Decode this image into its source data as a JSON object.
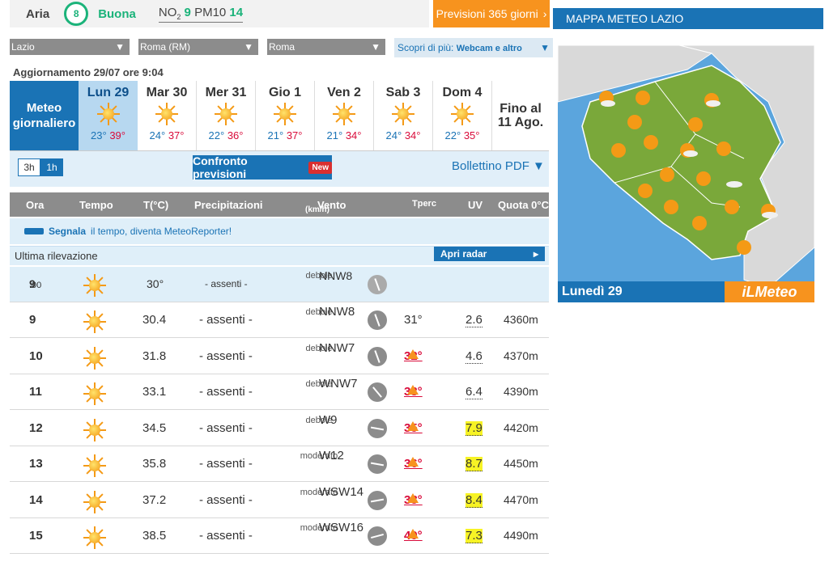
{
  "air": {
    "label": "Aria",
    "index": "8",
    "quality": "Buona",
    "no2_label": "NO",
    "no2_sub": "2",
    "no2_val": "9",
    "pm_label": "PM10",
    "pm_val": "14"
  },
  "btn365": "Previsioni 365 giorni",
  "map": {
    "title": "MAPPA METEO LAZIO",
    "day": "Lunedì 29",
    "logo": "iLMeteo"
  },
  "selects": {
    "region": "Lazio",
    "province": "Roma (RM)",
    "city": "Roma"
  },
  "scopri": {
    "label": "Scopri di più:",
    "value": "Webcam e altro"
  },
  "updated": "Aggiornamento 29/07 ore 9:04",
  "daily": {
    "label_line1": "Meteo",
    "label_line2": "giornaliero",
    "days": [
      {
        "name": "Lun 29",
        "min": "23°",
        "max": "39°"
      },
      {
        "name": "Mar 30",
        "min": "24°",
        "max": "37°"
      },
      {
        "name": "Mer 31",
        "min": "22°",
        "max": "36°"
      },
      {
        "name": "Gio 1",
        "min": "21°",
        "max": "37°"
      },
      {
        "name": "Ven 2",
        "min": "21°",
        "max": "34°"
      },
      {
        "name": "Sab 3",
        "min": "24°",
        "max": "34°"
      },
      {
        "name": "Dom 4",
        "min": "22°",
        "max": "35°"
      }
    ],
    "end_line1": "Fino al",
    "end_line2": "11 Ago."
  },
  "hours": {
    "h3": "3h",
    "h1": "1h"
  },
  "confronto": {
    "label": "Confronto previsioni",
    "badge": "New"
  },
  "pdf": "Bollettino PDF ▼",
  "table": {
    "headers": {
      "ora": "Ora",
      "tempo": "Tempo",
      "temp": "T(°C)",
      "prec": "Precipitazioni",
      "vento": "Vento",
      "vento_unit": "(km/h)",
      "tperc": "Tperc",
      "uv": "UV",
      "quota": "Quota 0°C"
    },
    "segnala_bold": "Segnala",
    "segnala_rest": "il tempo, diventa MeteoReporter!",
    "ultima": "Ultima rilevazione",
    "radar": "Apri radar",
    "current": {
      "ora": "9",
      "ora_min": ":00",
      "temp": "30°",
      "prec": "- assenti -",
      "wind": "NNW8",
      "wind_desc": "debole"
    },
    "rows": [
      {
        "ora": "9",
        "temp": "30.4",
        "prec": "- assenti -",
        "wind": "NNW8",
        "wind_desc": "debole",
        "tperc": "31°",
        "uv": "2.6",
        "quota": "4360m"
      },
      {
        "ora": "10",
        "temp": "31.8",
        "prec": "- assenti -",
        "wind": "NNW7",
        "wind_desc": "debole",
        "tperc": "32°",
        "uv": "4.6",
        "quota": "4370m"
      },
      {
        "ora": "11",
        "temp": "33.1",
        "prec": "- assenti -",
        "wind": "WNW7",
        "wind_desc": "debole",
        "tperc": "33°",
        "uv": "6.4",
        "quota": "4390m"
      },
      {
        "ora": "12",
        "temp": "34.5",
        "prec": "- assenti -",
        "wind": "W9",
        "wind_desc": "debole",
        "tperc": "35°",
        "uv": "7.9",
        "quota": "4420m"
      },
      {
        "ora": "13",
        "temp": "35.8",
        "prec": "- assenti -",
        "wind": "W12",
        "wind_desc": "moderato",
        "tperc": "36°",
        "uv": "8.7",
        "quota": "4450m"
      },
      {
        "ora": "14",
        "temp": "37.2",
        "prec": "- assenti -",
        "wind": "WSW14",
        "wind_desc": "moderato",
        "tperc": "38°",
        "uv": "8.4",
        "quota": "4470m"
      },
      {
        "ora": "15",
        "temp": "38.5",
        "prec": "- assenti -",
        "wind": "WSW16",
        "wind_desc": "moderato",
        "tperc": "40°",
        "uv": "7.3",
        "quota": "4490m"
      }
    ]
  }
}
